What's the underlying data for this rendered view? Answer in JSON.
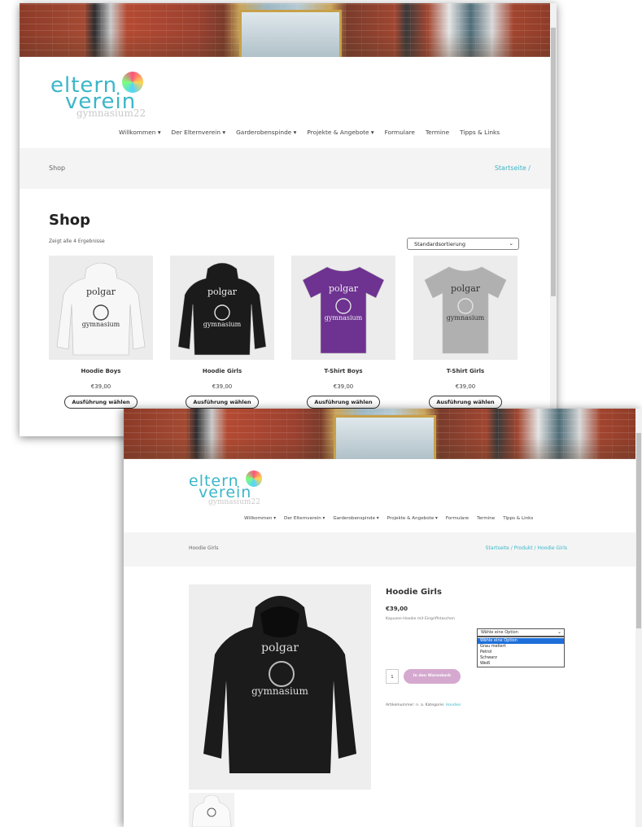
{
  "site": {
    "logo_line1": "eltern",
    "logo_line2": "verein",
    "logo_sub": "gymnasium22",
    "nav": [
      "Willkommen ▾",
      "Der Elternverein ▾",
      "Garderobenspinde ▾",
      "Projekte & Angebote ▾",
      "Formulare",
      "Termine",
      "Tipps & Links"
    ]
  },
  "shop_page": {
    "bar_title": "Shop",
    "breadcrumb": "Startseite  /",
    "heading": "Shop",
    "results_text": "Zeigt alle 4 Ergebnisse",
    "sort_value": "Standardsortierung",
    "products": [
      {
        "name": "Hoodie Boys",
        "price": "€39,00",
        "button": "Ausführung wählen",
        "color": "#f7f7f7",
        "kind": "hoodie"
      },
      {
        "name": "Hoodie Girls",
        "price": "€39,00",
        "button": "Ausführung wählen",
        "color": "#1b1b1b",
        "kind": "hoodie"
      },
      {
        "name": "T-Shirt Boys",
        "price": "€39,00",
        "button": "Ausführung wählen",
        "color": "#6e3291",
        "kind": "tshirt"
      },
      {
        "name": "T-Shirt Girls",
        "price": "€39,00",
        "button": "Ausführung wählen",
        "color": "#b0b0b0",
        "kind": "tshirt"
      }
    ],
    "print_text_1": "polgar",
    "print_text_2": "gymnasium"
  },
  "product_page": {
    "bar_title": "Hoodie Girls",
    "breadcrumb": "Startseite  /  Produkt  /  Hoodie Girls",
    "title": "Hoodie Girls",
    "price": "€39,00",
    "description": "Kapuzen-Hoodie mit Eingriffstaschen",
    "select_value": "Wähle eine Option",
    "options": [
      "Wähle eine Option",
      "Grau meliert",
      "Petrol",
      "Schwarz",
      "Weiß"
    ],
    "quantity": "1",
    "cart_button": "In den Warenkorb",
    "meta_text": "Artikelnummer: n. a.  Kategorie:",
    "category_link": "Hoodies",
    "print_text_1": "polgar",
    "print_text_2": "gymnasium"
  },
  "colors": {
    "accent": "#3ab6c8",
    "cart_button": "#d5a9cf",
    "hoodie_black": "#1b1b1b",
    "hoodie_white": "#f7f7f7",
    "tshirt_purple": "#6e3291",
    "tshirt_grey": "#b0b0b0"
  }
}
